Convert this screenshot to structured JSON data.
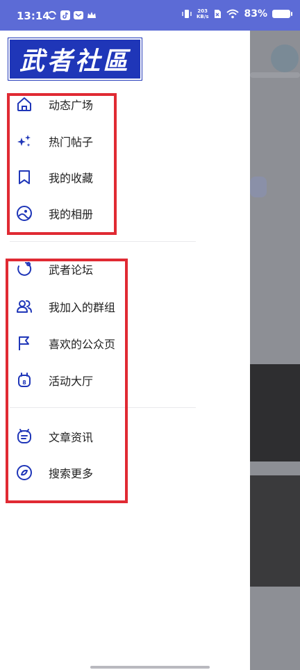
{
  "status_bar": {
    "time": "13:14",
    "net_speed_value": "203",
    "net_speed_unit": "KB/s",
    "battery_percent": "83%"
  },
  "drawer": {
    "logo_text": "武者社區",
    "groups": [
      {
        "items": [
          {
            "label": "动态广场",
            "icon": "home-icon"
          },
          {
            "label": "热门帖子",
            "icon": "sparkle-icon"
          },
          {
            "label": "我的收藏",
            "icon": "bookmark-icon"
          },
          {
            "label": "我的相册",
            "icon": "album-icon"
          }
        ]
      },
      {
        "items": [
          {
            "label": "武者论坛",
            "icon": "forum-icon"
          },
          {
            "label": "我加入的群组",
            "icon": "group-icon"
          },
          {
            "label": "喜欢的公众页",
            "icon": "flag-icon"
          },
          {
            "label": "活动大厅",
            "icon": "calendar-icon"
          }
        ]
      },
      {
        "items": [
          {
            "label": "文章资讯",
            "icon": "article-icon"
          },
          {
            "label": "搜索更多",
            "icon": "compass-icon"
          }
        ]
      }
    ]
  },
  "colors": {
    "accent": "#1f36b8",
    "highlight": "#e02a33",
    "status_bar": "#5c6bd6"
  }
}
